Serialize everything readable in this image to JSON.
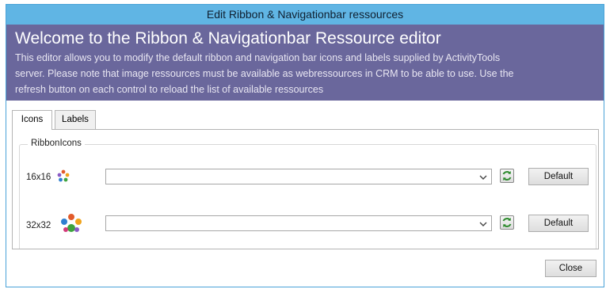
{
  "window": {
    "title": "Edit Ribbon & Navigationbar ressources"
  },
  "banner": {
    "heading": "Welcome to the Ribbon & Navigationbar Ressource editor",
    "line1": "This editor allows you to modify the default ribbon and navigation bar icons and labels supplied by ActivityTools",
    "line2": "server. Please note that image ressources must be available as webressources in CRM to be able to use. Use the",
    "line3": "refresh button on each control to reload the list of available ressources"
  },
  "tabs": [
    {
      "label": "Icons",
      "selected": true
    },
    {
      "label": "Labels",
      "selected": false
    }
  ],
  "ribbon_icons": {
    "group_label": "RibbonIcons",
    "rows": [
      {
        "size_label": "16x16",
        "icon": "ribbon-16-icon",
        "selected_value": "",
        "default_label": "Default"
      },
      {
        "size_label": "32x32",
        "icon": "ribbon-32-icon",
        "selected_value": "",
        "default_label": "Default"
      }
    ]
  },
  "footer": {
    "close_label": "Close"
  },
  "colors": {
    "titlebar": "#60b5e4",
    "banner": "#6a679c",
    "refresh_green": "#2e8b2e"
  }
}
